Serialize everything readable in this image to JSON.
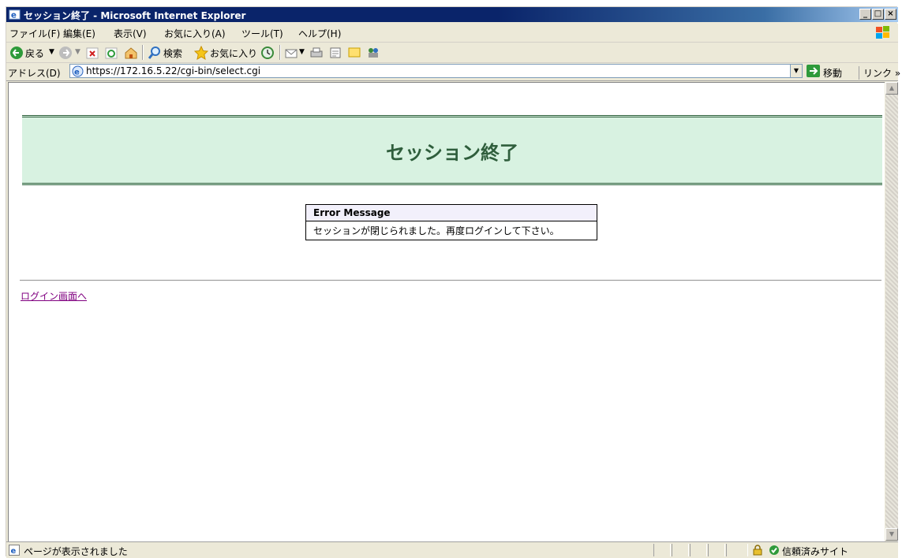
{
  "window": {
    "title": "セッション終了 - Microsoft Internet Explorer"
  },
  "menubar": {
    "items": [
      "ファイル(F)",
      "編集(E)",
      "表示(V)",
      "お気に入り(A)",
      "ツール(T)",
      "ヘルプ(H)"
    ]
  },
  "toolbar": {
    "back_label": "戻る",
    "search_label": "検索",
    "favorites_label": "お気に入り"
  },
  "addressbar": {
    "label": "アドレス(D)",
    "url": "https://172.16.5.22/cgi-bin/select.cgi",
    "go_label": "移動",
    "links_label": "リンク »"
  },
  "page": {
    "heading": "セッション終了",
    "error_box": {
      "header": "Error Message",
      "message": "セッションが閉じられました。再度ログインして下さい。"
    },
    "login_link": "ログイン画面へ"
  },
  "statusbar": {
    "text": "ページが表示されました",
    "zone": "信頼済みサイト"
  },
  "colors": {
    "titlebar": "#0a246a",
    "banner_bg": "#d8f2e1",
    "banner_text": "#2f5e3c",
    "link_visited": "#800080"
  },
  "icons": {
    "app": "ie-icon",
    "back": "back-arrow-icon",
    "forward": "forward-arrow-icon",
    "stop": "stop-icon",
    "refresh": "refresh-icon",
    "home": "home-icon",
    "search": "search-icon",
    "favorites": "favorites-star-icon",
    "history": "history-icon",
    "mail": "mail-icon",
    "print": "print-icon",
    "edit": "edit-icon",
    "discuss": "discuss-icon",
    "messenger": "messenger-icon",
    "go": "go-arrow-icon",
    "lock": "lock-icon",
    "trusted": "trusted-zone-icon"
  }
}
